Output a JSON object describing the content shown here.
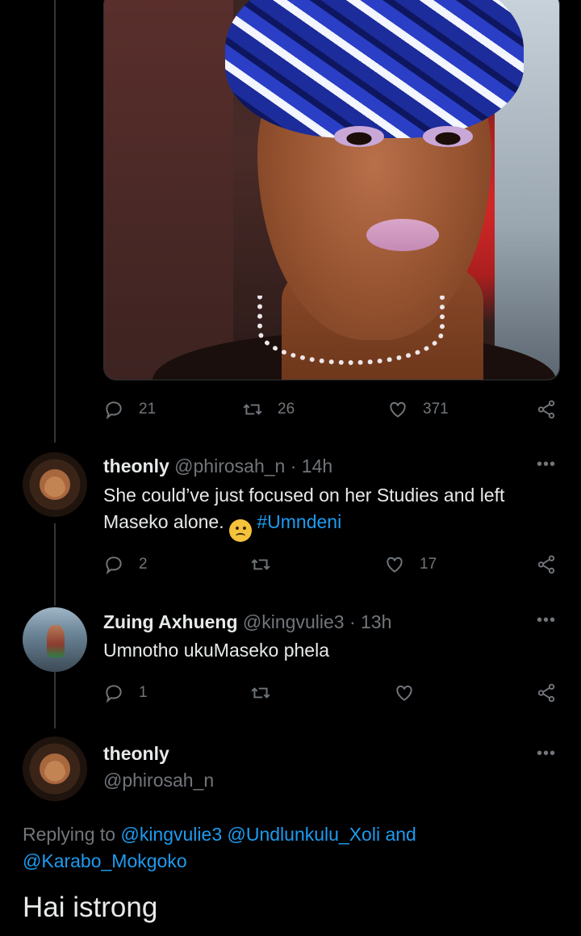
{
  "main_tweet": {
    "media_alt": "",
    "replies": "21",
    "retweets": "26",
    "likes": "371"
  },
  "reply1": {
    "display_name": "theonly",
    "handle": "@phirosah_n",
    "time": "· 14h",
    "text_before": "She could’ve just focused on her Studies and left Maseko alone.",
    "emoji": "🙁",
    "hashtag": "#Umndeni",
    "replies": "2",
    "retweets": "",
    "likes": "17"
  },
  "reply2": {
    "display_name": "Zuing Axhueng",
    "handle": "@kingvulie3",
    "time": "· 13h",
    "text": "Umnotho ukuMaseko phela",
    "replies": "1",
    "retweets": "",
    "likes": ""
  },
  "focused_tweet": {
    "display_name": "theonly",
    "handle": "@phirosah_n",
    "replying_prefix": "Replying to",
    "mention1": "@kingvulie3",
    "mention2": "@Undlunkulu_Xoli",
    "and_word": "and",
    "mention3": "@Karabo_Mokgoko",
    "text": "Hai istrong"
  },
  "icons": {
    "reply": "reply-icon",
    "retweet": "retweet-icon",
    "like": "heart-icon",
    "share": "share-icon",
    "more": "more-icon"
  },
  "colors": {
    "background": "#000000",
    "text": "#e7e9ea",
    "muted": "#71767b",
    "link": "#1d9bf0"
  }
}
